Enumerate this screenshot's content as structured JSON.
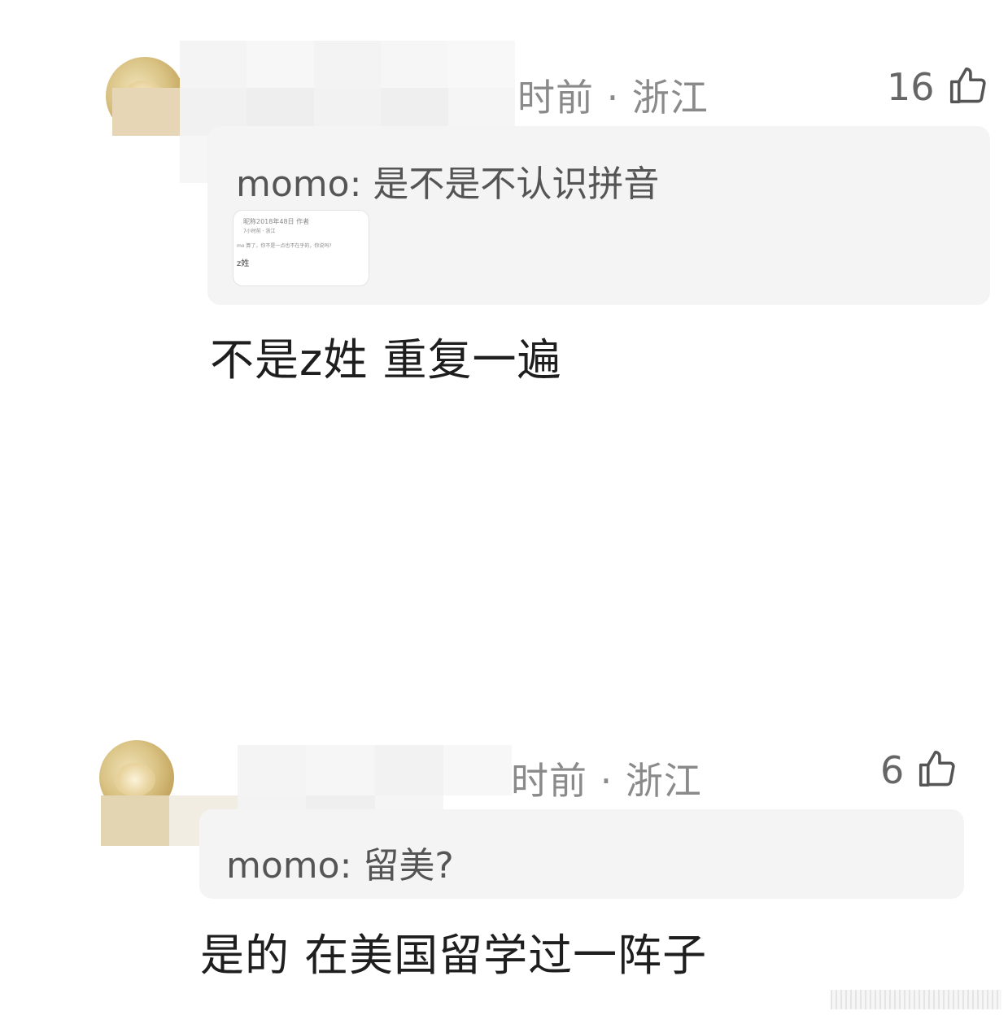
{
  "comments": [
    {
      "meta": "时前 · 浙江",
      "likes": "16",
      "quote": {
        "text": "momo: 是不是不认识拼音",
        "thumbnail_lines": [
          "昵称2018年48日 作者",
          "7小时前 · 浙江",
          "mo 算了，你不是一点也不在乎的，你说吗?",
          "z姓"
        ]
      },
      "reply": "不是z姓 重复一遍",
      "icons": {
        "like": "thumbs-up-icon"
      }
    },
    {
      "meta": "时前 · 浙江",
      "likes": "6",
      "quote": {
        "text": "momo: 留美?"
      },
      "reply": "是的 在美国留学过一阵子",
      "icons": {
        "like": "thumbs-up-icon"
      }
    }
  ],
  "colors": {
    "meta_gray": "#8a8a8a",
    "quote_bg": "#f4f4f4",
    "text_dark": "#1e1e1e"
  }
}
